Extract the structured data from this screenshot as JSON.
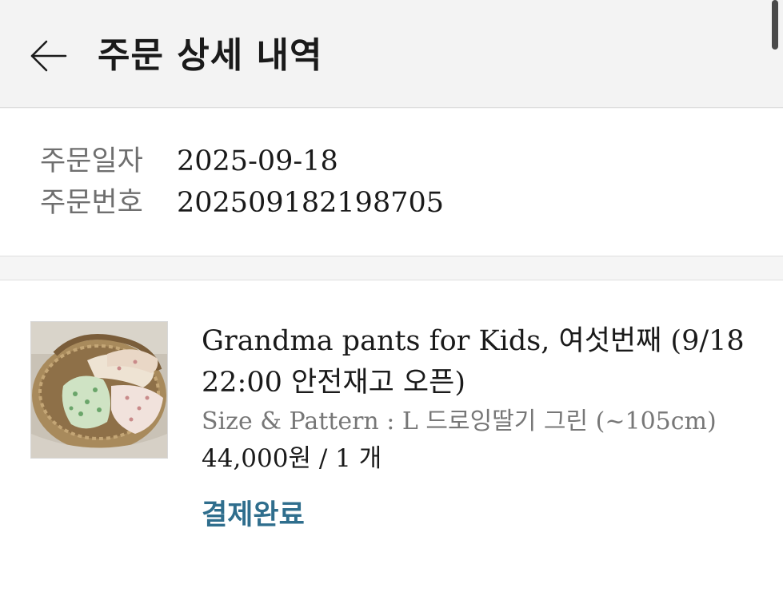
{
  "header": {
    "title": "주문 상세 내역",
    "back_icon": "arrow-left-icon"
  },
  "order": {
    "date_label": "주문일자",
    "date_value": "2025-09-18",
    "number_label": "주문번호",
    "number_value": "202509182198705"
  },
  "product": {
    "image_name": "product-thumbnail",
    "name": "Grandma pants for Kids, 여섯번째 (9/18 22:00 안전재고 오픈)",
    "option": "Size & Pattern : L 드로잉딸기 그린 (~105cm)",
    "price": "44,000원 / 1 개",
    "status": "결제완료"
  },
  "colors": {
    "status": "#2f6e8d",
    "label": "#6f6f6f",
    "background": "#f5f5f5"
  }
}
